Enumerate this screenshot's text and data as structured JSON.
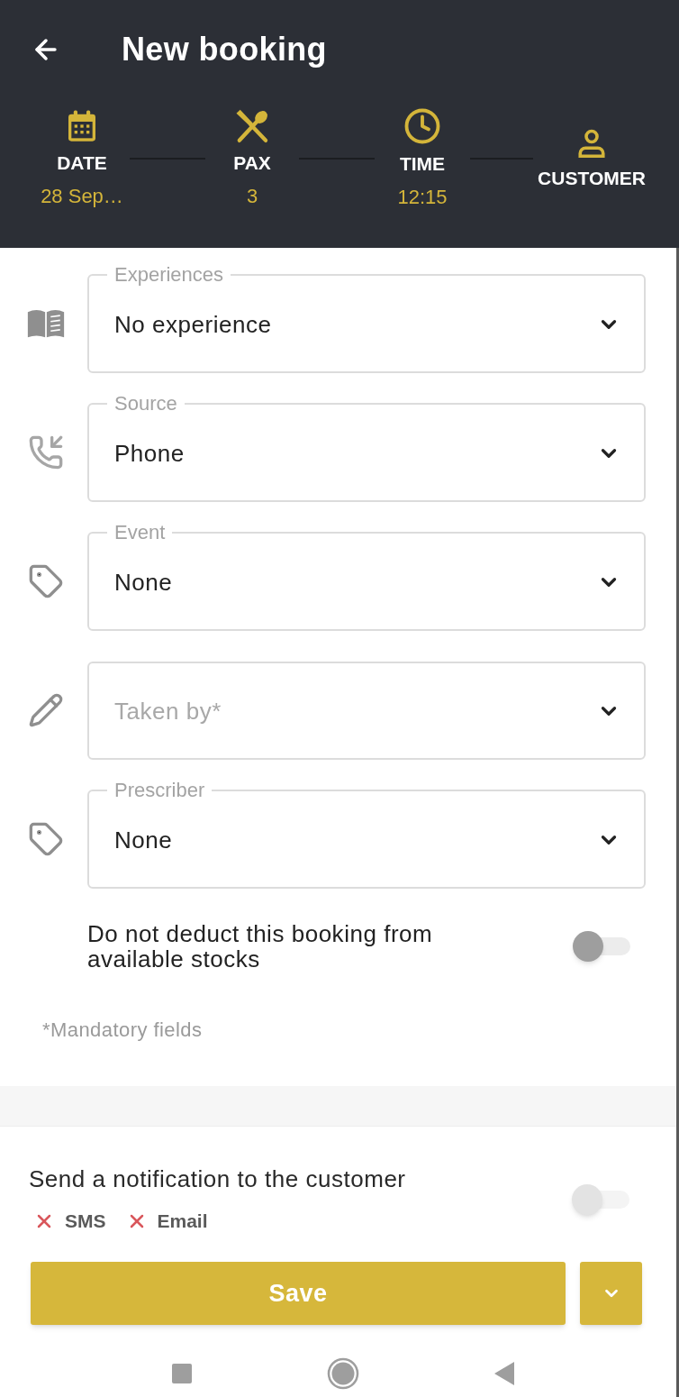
{
  "header": {
    "title": "New booking"
  },
  "steps": [
    {
      "label": "DATE",
      "value": "28 Sep…"
    },
    {
      "label": "PAX",
      "value": "3"
    },
    {
      "label": "TIME",
      "value": "12:15"
    },
    {
      "label": "CUSTOMER"
    }
  ],
  "fields": [
    {
      "label": "Experiences",
      "value": "No experience"
    },
    {
      "label": "Source",
      "value": "Phone"
    },
    {
      "label": "Event",
      "value": "None"
    },
    {
      "placeholder": "Taken by*"
    },
    {
      "label": "Prescriber",
      "value": "None"
    }
  ],
  "stock_toggle": {
    "label": "Do not deduct this booking from available stocks",
    "on": false
  },
  "mandatory_note": "*Mandatory fields",
  "notification": {
    "label": "Send a notification to the customer",
    "on": false,
    "disabled": true,
    "channels": [
      {
        "label": "SMS",
        "enabled": false
      },
      {
        "label": "Email",
        "enabled": false
      }
    ]
  },
  "actions": {
    "save": "Save"
  }
}
